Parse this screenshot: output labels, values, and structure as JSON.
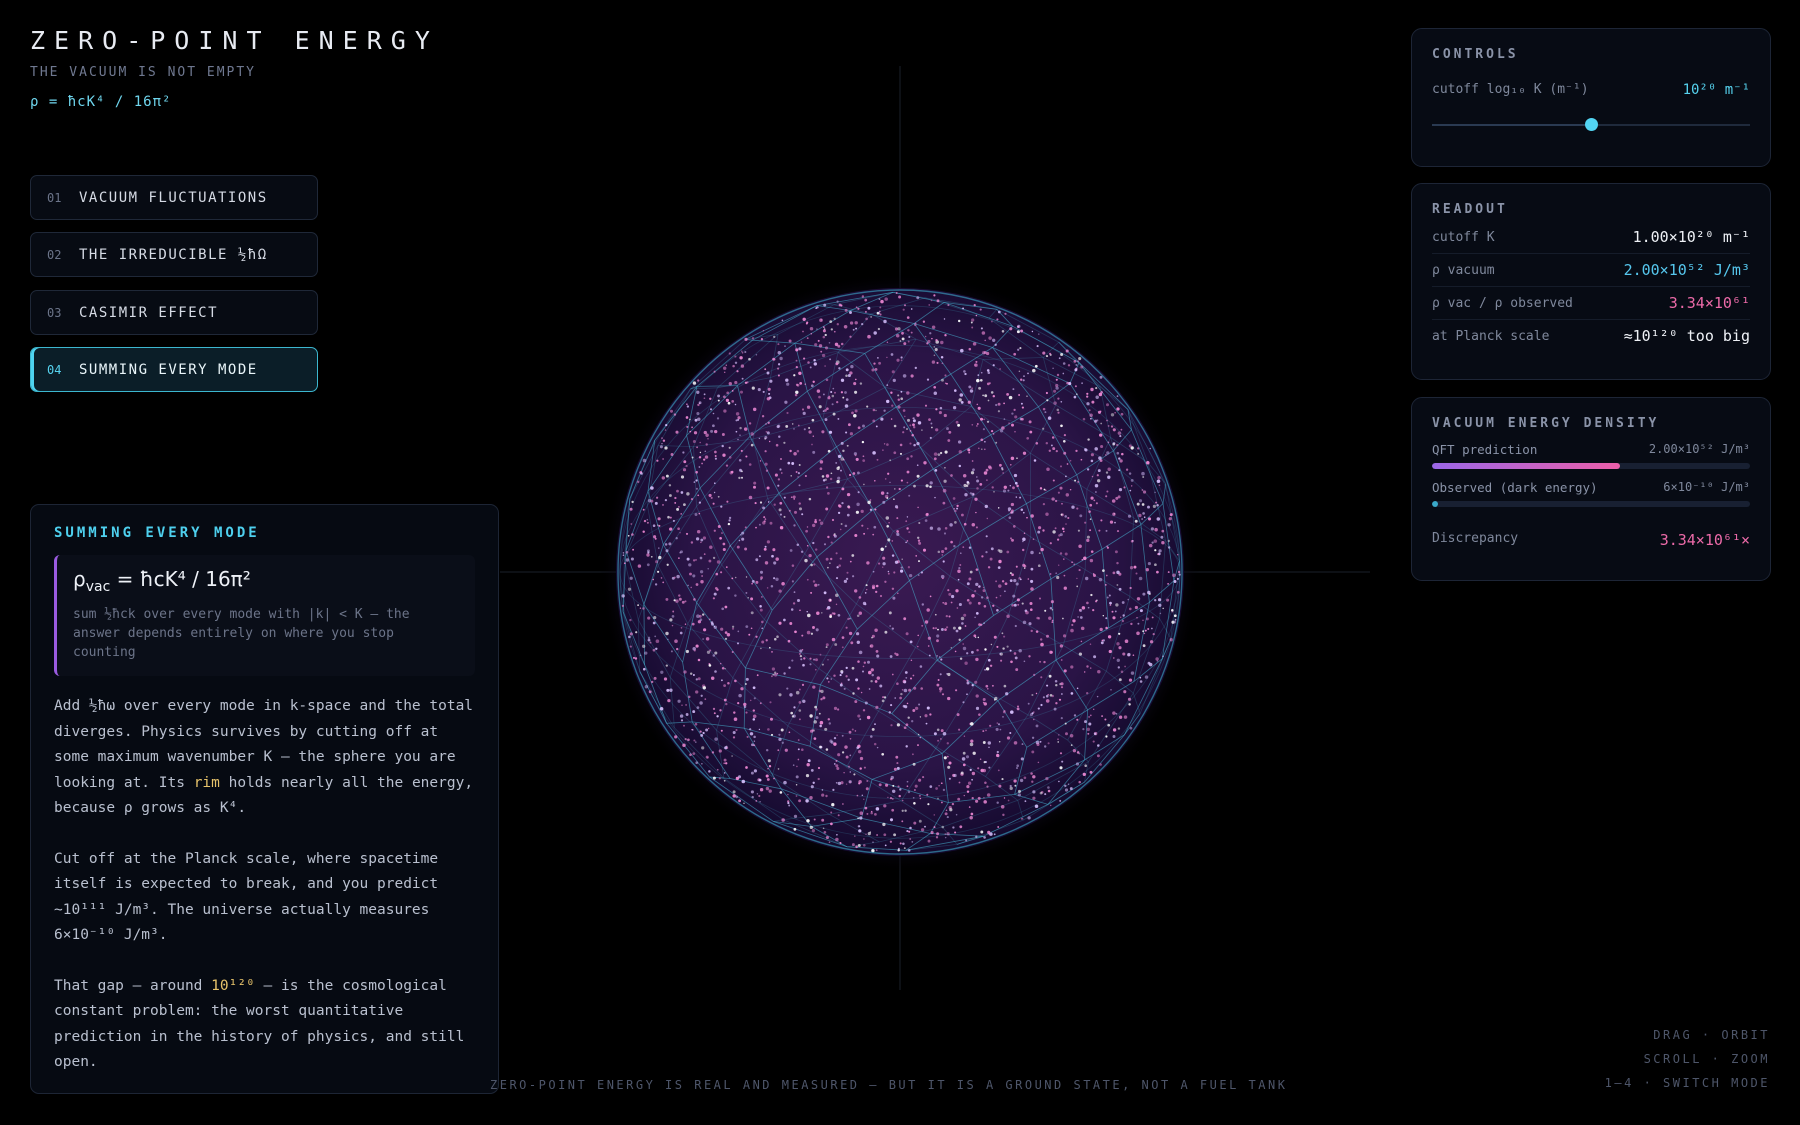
{
  "header": {
    "title": "ZERO-POINT ENERGY",
    "subtitle": "THE VACUUM IS NOT EMPTY",
    "formula": "ρ = ħcK⁴ / 16π²"
  },
  "modes": [
    {
      "num": "01",
      "label": "VACUUM FLUCTUATIONS",
      "active": false
    },
    {
      "num": "02",
      "label": "THE IRREDUCIBLE ½ħΩ",
      "active": false
    },
    {
      "num": "03",
      "label": "CASIMIR EFFECT",
      "active": false
    },
    {
      "num": "04",
      "label": "SUMMING EVERY MODE",
      "active": true
    }
  ],
  "info": {
    "title": "SUMMING EVERY MODE",
    "formula_lhs": "ρ",
    "formula_sub": "vac",
    "formula_rhs": " = ħcK⁴ / 16π²",
    "formula_note": "sum ½ħck over every mode with |k| < K — the answer depends entirely on where you stop counting",
    "p1_a": "Add ½ħω over every mode in k-space and the total diverges. Physics survives by cutting off at some maximum wavenumber K — the sphere you are looking at. Its ",
    "p1_hl": "rim",
    "p1_b": " holds nearly all the energy, because ρ grows as K⁴.",
    "p2": "Cut off at the Planck scale, where spacetime itself is expected to break, and you predict ~10¹¹¹ J/m³. The universe actually measures 6×10⁻¹⁰ J/m³.",
    "p3_a": "That gap — around ",
    "p3_hl": "10¹²⁰",
    "p3_b": " — is the cosmological constant problem: the worst quantitative prediction in the history of physics, and still open."
  },
  "controls": {
    "title": "CONTROLS",
    "cutoff_label": "cutoff log₁₀ K (m⁻¹)",
    "cutoff_value": "10²⁰ m⁻¹",
    "slider_fraction": 0.5
  },
  "readout": {
    "title": "READOUT",
    "rows": [
      {
        "label": "cutoff K",
        "value": "1.00×10²⁰ m⁻¹",
        "tone": "white"
      },
      {
        "label": "ρ vacuum",
        "value": "2.00×10⁵² J/m³",
        "tone": "cyan"
      },
      {
        "label": "ρ vac / ρ observed",
        "value": "3.34×10⁶¹",
        "tone": "pink"
      },
      {
        "label": "at Planck scale",
        "value": "≈10¹²⁰ too big",
        "tone": "white"
      }
    ]
  },
  "density": {
    "title": "VACUUM ENERGY DENSITY",
    "qft_label": "QFT prediction",
    "qft_value": "2.00×10⁵² J/m³",
    "qft_fraction": 0.59,
    "obs_label": "Observed (dark energy)",
    "obs_value": "6×10⁻¹⁰ J/m³",
    "obs_fraction": 0.02,
    "disc_label": "Discrepancy",
    "disc_value": "3.34×10⁶¹×"
  },
  "footer": {
    "tagline": "ZERO-POINT ENERGY IS REAL AND MEASURED — BUT IT IS A GROUND STATE, NOT A FUEL TANK",
    "hint_1": "DRAG · ORBIT",
    "hint_2": "SCROLL · ZOOM",
    "hint_3": "1–4 · SWITCH MODE"
  },
  "colors": {
    "accent_cyan": "#56d3ef",
    "accent_pink": "#ec6aa8",
    "accent_purple": "#9b67e8",
    "highlight_amber": "#e7c36b",
    "background": "#000000"
  }
}
